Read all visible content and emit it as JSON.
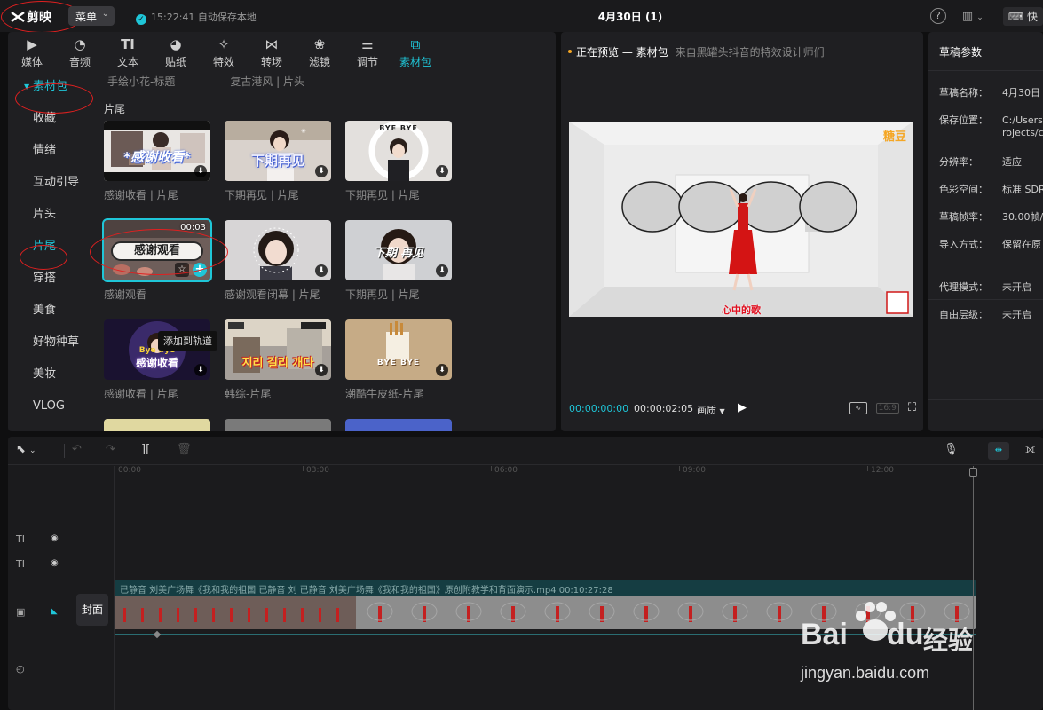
{
  "app": {
    "logo_text": "剪映",
    "menu_label": "菜单",
    "autosave_text": "15:22:41 自动保存本地",
    "project_title": "4月30日 (1)",
    "shortcut_label": "快"
  },
  "media_tabs": [
    {
      "label": "媒体",
      "icon": "media-icon"
    },
    {
      "label": "音频",
      "icon": "audio-icon"
    },
    {
      "label": "文本",
      "icon": "text-icon"
    },
    {
      "label": "贴纸",
      "icon": "sticker-icon"
    },
    {
      "label": "特效",
      "icon": "effects-icon"
    },
    {
      "label": "转场",
      "icon": "transition-icon"
    },
    {
      "label": "滤镜",
      "icon": "filter-icon"
    },
    {
      "label": "调节",
      "icon": "adjust-icon"
    },
    {
      "label": "素材包",
      "icon": "material-pack-icon",
      "active": true
    }
  ],
  "sidebar": {
    "items": [
      {
        "label": "素材包",
        "active": true
      },
      {
        "label": "收藏"
      },
      {
        "label": "情绪"
      },
      {
        "label": "互动引导"
      },
      {
        "label": "片头"
      },
      {
        "label": "片尾",
        "active": true
      },
      {
        "label": "穿搭"
      },
      {
        "label": "美食"
      },
      {
        "label": "好物种草"
      },
      {
        "label": "美妆"
      },
      {
        "label": "VLOG"
      }
    ]
  },
  "content": {
    "top_labels": [
      "手绘小花-标题",
      "复古港风 | 片头"
    ],
    "section_title": "片尾",
    "cards": [
      {
        "label": "感谢收看 | 片尾",
        "thumb_text": "*感谢收看*"
      },
      {
        "label": "下期再见 | 片尾",
        "thumb_text": "下期再见"
      },
      {
        "label": "下期再见 | 片尾",
        "thumb_text": "BYE BYE"
      },
      {
        "label": "感谢观看",
        "thumb_text": "感谢观看",
        "duration": "00:03",
        "selected": true
      },
      {
        "label": "感谢观看闭幕 | 片尾",
        "thumb_text": ""
      },
      {
        "label": "下期再见 | 片尾",
        "thumb_text": "下期 再见"
      },
      {
        "label": "感谢收看 | 片尾",
        "thumb_text": "感谢收看",
        "thumb_sub": "Bye bye"
      },
      {
        "label": "韩综-片尾",
        "thumb_text": "지리 길리 개다"
      },
      {
        "label": "潮酷牛皮纸-片尾",
        "thumb_text": "BYE BYE"
      }
    ],
    "tooltip": "添加到轨道"
  },
  "preview": {
    "status": "正在预览 — 素材包",
    "source": "来自黑罐头抖音的特效设计师们",
    "time_current": "00:00:00:00",
    "time_total": "00:00:02:05",
    "quality": "画质",
    "ratio": "16:9",
    "video_logo": "糖豆",
    "video_caption": "心中的歌"
  },
  "draft": {
    "title": "草稿参数",
    "rows": [
      {
        "key": "草稿名称：",
        "value": "4月30日 ("
      },
      {
        "key": "保存位置：",
        "value": "C:/Users/",
        "value2": "rojects/c"
      },
      {
        "key": "分辨率：",
        "value": "适应"
      },
      {
        "key": "色彩空间：",
        "value": "标准 SDR"
      },
      {
        "key": "草稿帧率：",
        "value": "30.00帧/"
      },
      {
        "key": "导入方式：",
        "value": "保留在原"
      },
      {
        "key": "代理模式：",
        "value": "未开启"
      },
      {
        "key": "自由层级：",
        "value": "未开启"
      }
    ]
  },
  "timeline": {
    "ruler_labels": [
      "00:00",
      "03:00",
      "06:00",
      "09:00",
      "12:00"
    ],
    "cover_label": "封面",
    "clip_text": "已静音   刘美广场舞《我和我的祖国   已静音   刘  已静音   刘美广场舞《我和我的祖国》原创附教学和背面演示.mp4   00:10:27:28"
  },
  "watermark": {
    "brand": "Bai",
    "brand2": "du",
    "suffix": "经验",
    "url": "jingyan.baidu.com"
  },
  "colors": {
    "accent": "#1fc6d8",
    "annotation_red": "#e02020"
  }
}
